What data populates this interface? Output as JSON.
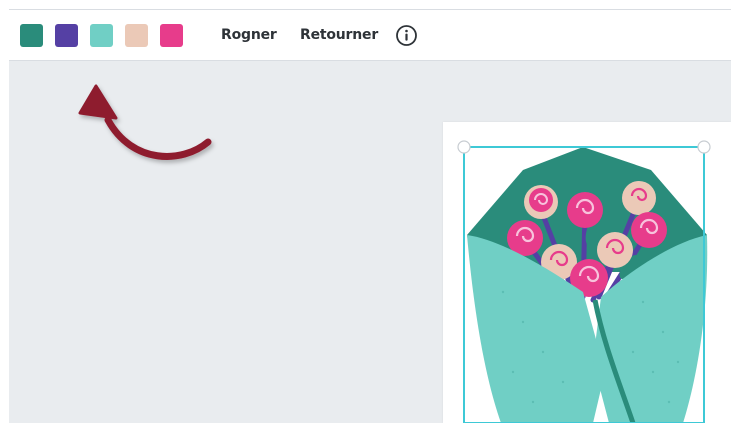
{
  "toolbar": {
    "swatches": [
      {
        "color": "#2a8c7b",
        "label": "dark-teal"
      },
      {
        "color": "#5540a4",
        "label": "purple"
      },
      {
        "color": "#70cfc5",
        "label": "light-teal"
      },
      {
        "color": "#ebc9b7",
        "label": "peach"
      },
      {
        "color": "#e73c8b",
        "label": "pink"
      }
    ],
    "crop_label": "Rogner",
    "flip_label": "Retourner",
    "info_icon": "info-circle-icon"
  },
  "annotation": {
    "arrow_color": "#8e1b2f",
    "arrow_icon": "curved-arrow-icon"
  },
  "canvas": {
    "selection_color": "#3ec9d6",
    "artwork": "flower-bouquet-illustration"
  }
}
